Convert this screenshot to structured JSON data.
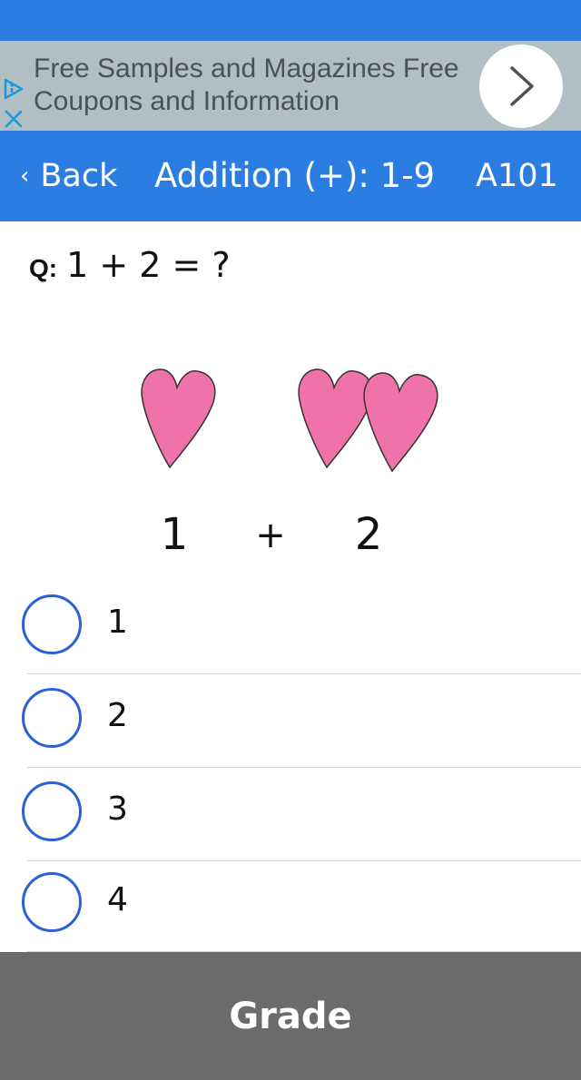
{
  "ad": {
    "text": "Free Samples and Magazines Free Coupons and Information",
    "adchoices_icon": "adchoices-triangle-icon",
    "close_icon": "close-x-icon",
    "arrow_icon": "chevron-right-icon"
  },
  "nav": {
    "back_label": "Back",
    "back_icon": "chevron-left-icon",
    "title": "Addition (+): 1-9",
    "lesson_code": "A101"
  },
  "question": {
    "prefix": "Q:",
    "text": "1 + 2 = ?"
  },
  "illustration": {
    "left_count": 1,
    "right_count": 2,
    "left_number": "1",
    "operator": "+",
    "right_number": "2",
    "heart_color": "#ef72a8"
  },
  "options": [
    {
      "label": "1"
    },
    {
      "label": "2"
    },
    {
      "label": "3"
    },
    {
      "label": "4"
    }
  ],
  "grade_button": {
    "label": "Grade"
  },
  "colors": {
    "primary": "#2b7de1",
    "ad_background": "#b1bec4",
    "radio_border": "#2a62d6",
    "grade_background": "#6b6b6b"
  }
}
